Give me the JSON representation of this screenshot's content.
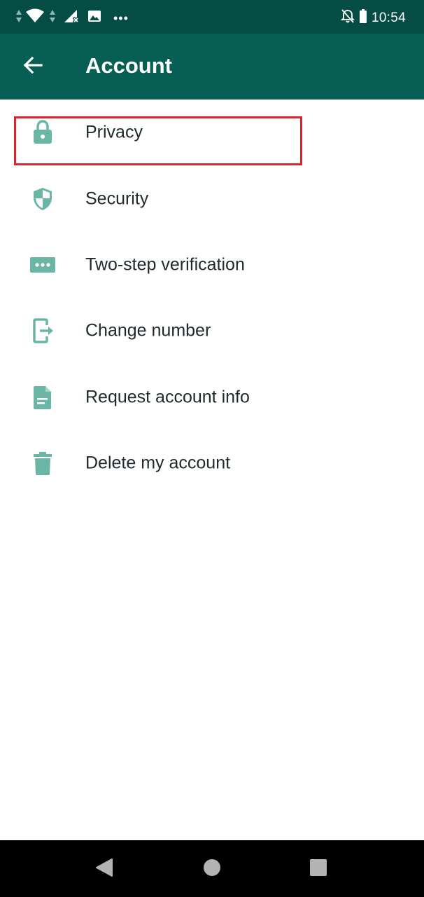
{
  "status_bar": {
    "time": "10:54",
    "overflow_dots": "•••",
    "icons": [
      "data-arrows-icon",
      "wifi-icon",
      "signal-off-icon",
      "image-notification-icon",
      "notifications-off-icon",
      "battery-icon"
    ]
  },
  "app_bar": {
    "title": "Account",
    "back_icon": "arrow-left-icon"
  },
  "colors": {
    "status_bar": "#054d44",
    "app_bar": "#075e54",
    "icon_tint": "#6bb5a6",
    "text": "#1e2a2c",
    "highlight": "#d9262e"
  },
  "menu": {
    "items": [
      {
        "label": "Privacy",
        "icon": "lock-icon"
      },
      {
        "label": "Security",
        "icon": "shield-icon"
      },
      {
        "label": "Two-step verification",
        "icon": "dots-password-icon"
      },
      {
        "label": "Change number",
        "icon": "change-number-icon"
      },
      {
        "label": "Request account info",
        "icon": "document-icon"
      },
      {
        "label": "Delete my account",
        "icon": "trash-icon"
      }
    ]
  },
  "nav_bar": {
    "buttons": [
      "back-triangle-icon",
      "home-circle-icon",
      "recents-square-icon"
    ]
  }
}
